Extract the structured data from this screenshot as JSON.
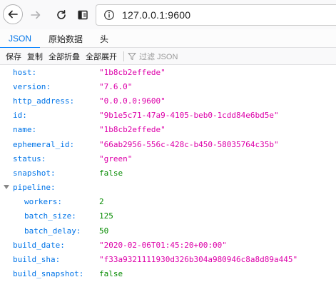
{
  "browser": {
    "url": "127.0.0.1:9600"
  },
  "tabs": [
    {
      "label": "JSON",
      "active": true
    },
    {
      "label": "原始数据",
      "active": false
    },
    {
      "label": "头",
      "active": false
    }
  ],
  "actions": {
    "save": "保存",
    "copy": "复制",
    "collapse_all": "全部折叠",
    "expand_all": "全部展开",
    "filter_placeholder": "过滤 JSON"
  },
  "json_rows": [
    {
      "key": "host:",
      "value": "\"1b8cb2effede\"",
      "type": "str"
    },
    {
      "key": "version:",
      "value": "\"7.6.0\"",
      "type": "str"
    },
    {
      "key": "http_address:",
      "value": "\"0.0.0.0:9600\"",
      "type": "str"
    },
    {
      "key": "id:",
      "value": "\"9b1e5c71-47a9-4105-beb0-1cdd84e6bd5e\"",
      "type": "str"
    },
    {
      "key": "name:",
      "value": "\"1b8cb2effede\"",
      "type": "str"
    },
    {
      "key": "ephemeral_id:",
      "value": "\"66ab2956-556c-428c-b450-58035764c35b\"",
      "type": "str"
    },
    {
      "key": "status:",
      "value": "\"green\"",
      "type": "str"
    },
    {
      "key": "snapshot:",
      "value": "false",
      "type": "bool"
    },
    {
      "key": "pipeline:",
      "value": "",
      "type": "obj"
    },
    {
      "key": "workers:",
      "value": "2",
      "type": "num"
    },
    {
      "key": "batch_size:",
      "value": "125",
      "type": "num"
    },
    {
      "key": "batch_delay:",
      "value": "50",
      "type": "num"
    },
    {
      "key": "build_date:",
      "value": "\"2020-02-06T01:45:20+00:00\"",
      "type": "str"
    },
    {
      "key": "build_sha:",
      "value": "\"f33a9321111930d326b304a980946c8a8d89a445\"",
      "type": "str"
    },
    {
      "key": "build_snapshot:",
      "value": "false",
      "type": "bool"
    }
  ]
}
